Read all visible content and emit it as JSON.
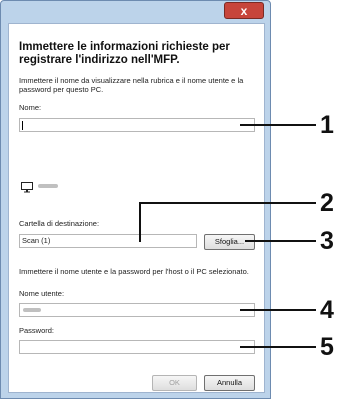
{
  "window": {
    "close_label": "x"
  },
  "dialog": {
    "heading": "Immettere le informazioni richieste per registrare l'indirizzo nell'MFP.",
    "intro": "Immettere il nome da visualizzare nella rubrica e il nome utente e la password per questo PC.",
    "name_label": "Nome:",
    "name_value": "",
    "folder_label": "Cartella di destinazione:",
    "folder_value": "Scan (1)",
    "browse_label": "Sfoglia...",
    "host_instructions": "Immettere il nome utente e la password per l'host o il PC selezionato.",
    "username_label": "Nome utente:",
    "password_label": "Password:",
    "password_value": "",
    "ok_label": "OK",
    "cancel_label": "Annulla"
  },
  "callouts": [
    "1",
    "2",
    "3",
    "4",
    "5"
  ]
}
